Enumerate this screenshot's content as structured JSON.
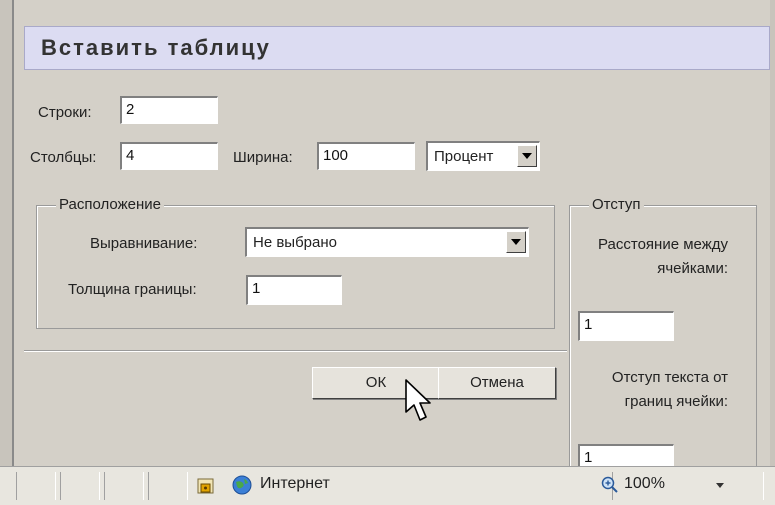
{
  "dialog": {
    "title": "Вставить таблицу",
    "rows_label": "Строки:",
    "rows_value": "2",
    "cols_label": "Столбцы:",
    "cols_value": "4",
    "width_label": "Ширина:",
    "width_value": "100",
    "width_unit": "Процент",
    "layout": {
      "legend": "Расположение",
      "align_label": "Выравнивание:",
      "align_value": "Не выбрано",
      "border_label": "Толщина границы:",
      "border_value": "1"
    },
    "padding": {
      "legend": "Отступ",
      "spacing_label": "Расстояние между ячейками:",
      "spacing_value": "1",
      "padding_label": "Отступ текста от границ ячейки:",
      "padding_value": "1"
    },
    "ok_label": "ОК",
    "cancel_label": "Отмена"
  },
  "statusbar": {
    "zone": "Интернет",
    "zoom": "100%",
    "zoom_icon": "zoom-magnifier-icon",
    "zone_icon": "globe-icon",
    "lock_icon": "security-lock-icon"
  }
}
